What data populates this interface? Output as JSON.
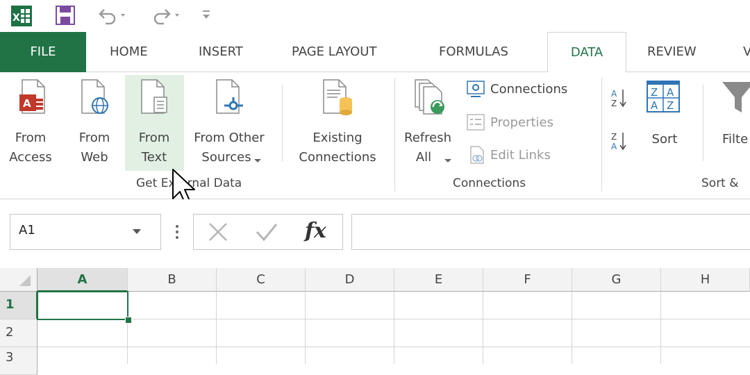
{
  "app": {
    "icon": "excel-icon"
  },
  "qat": {
    "save_icon": "save-icon",
    "undo_icon": "undo-icon",
    "redo_icon": "redo-icon",
    "customize_icon": "customize-qat-icon"
  },
  "tabs": [
    {
      "label": "FILE"
    },
    {
      "label": "HOME"
    },
    {
      "label": "INSERT"
    },
    {
      "label": "PAGE LAYOUT"
    },
    {
      "label": "FORMULAS"
    },
    {
      "label": "DATA"
    },
    {
      "label": "REVIEW"
    },
    {
      "label": "V"
    }
  ],
  "ribbon": {
    "get_external": {
      "from_access": {
        "line1": "From",
        "line2": "Access"
      },
      "from_web": {
        "line1": "From",
        "line2": "Web"
      },
      "from_text": {
        "line1": "From",
        "line2": "Text"
      },
      "from_other": {
        "line1": "From Other",
        "line2": "Sources"
      },
      "label": "Get External Data"
    },
    "existing": {
      "line1": "Existing",
      "line2": "Connections"
    },
    "connections": {
      "refresh": {
        "line1": "Refresh",
        "line2": "All"
      },
      "connections": "Connections",
      "properties": "Properties",
      "edit_links": "Edit Links",
      "label": "Connections"
    },
    "sort_filter": {
      "sort": "Sort",
      "filter": "Filte",
      "label": "Sort &"
    }
  },
  "formula_bar": {
    "namebox": "A1",
    "fx": "fx",
    "value": ""
  },
  "grid": {
    "columns": [
      "A",
      "B",
      "C",
      "D",
      "E",
      "F",
      "G",
      "H"
    ],
    "rows": [
      "1",
      "2",
      "3"
    ]
  },
  "colors": {
    "accent": "#217346"
  }
}
